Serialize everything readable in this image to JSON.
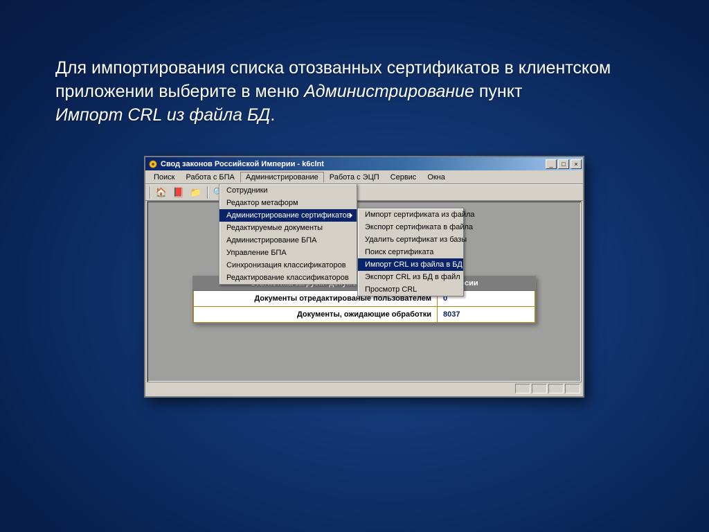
{
  "slide": {
    "line1a": "Для импортирования списка отозванных сертификатов в клиентском приложении выберите в меню ",
    "menu_word": "Администрирование",
    "line1b": " пункт ",
    "item_word": "Импорт CRL из файла БД",
    "period": "."
  },
  "window": {
    "title": "Свод законов Российской Империи - k6clnt",
    "minimize": "_",
    "maximize": "□",
    "close": "×"
  },
  "menubar": {
    "items": [
      "Поиск",
      "Работа с БПА",
      "Администрирование",
      "Работа с ЭЦП",
      "Сервис",
      "Окна"
    ],
    "open_index": 2
  },
  "dropdown1": {
    "items": [
      {
        "label": "Сотрудники",
        "submenu": false,
        "hl": false
      },
      {
        "label": "Редактор метаформ",
        "submenu": false,
        "hl": false
      },
      {
        "label": "Администрирование сертификатов",
        "submenu": true,
        "hl": true
      },
      {
        "label": "Редактируемые документы",
        "submenu": false,
        "hl": false
      },
      {
        "label": "Администрирование БПА",
        "submenu": false,
        "hl": false
      },
      {
        "label": "Управление БПА",
        "submenu": false,
        "hl": false
      },
      {
        "label": "Синхронизация классификаторов",
        "submenu": false,
        "hl": false
      },
      {
        "label": "Редактирование классификаторов",
        "submenu": false,
        "hl": false
      }
    ]
  },
  "dropdown2": {
    "items": [
      {
        "label": "Импорт сертификата из файла",
        "hl": false
      },
      {
        "label": "Экспорт сертификата в файла",
        "hl": false
      },
      {
        "label": "Удалить сертификат из базы",
        "hl": false
      },
      {
        "label": "Поиск сертификата",
        "hl": false
      },
      {
        "label": "Импорт CRL из файла в БД",
        "hl": true
      },
      {
        "label": "Экспорт CRL из БД в файл",
        "hl": false
      },
      {
        "label": "Просмотр CRL",
        "hl": false
      }
    ]
  },
  "stats": {
    "header": "Статистика загрузки документов из БД предыдущей версии",
    "row1_label": "Документы отредактированые пользователем",
    "row1_value": "0",
    "row2_label": "Документы, ожидающие обработки",
    "row2_value": "8037"
  }
}
